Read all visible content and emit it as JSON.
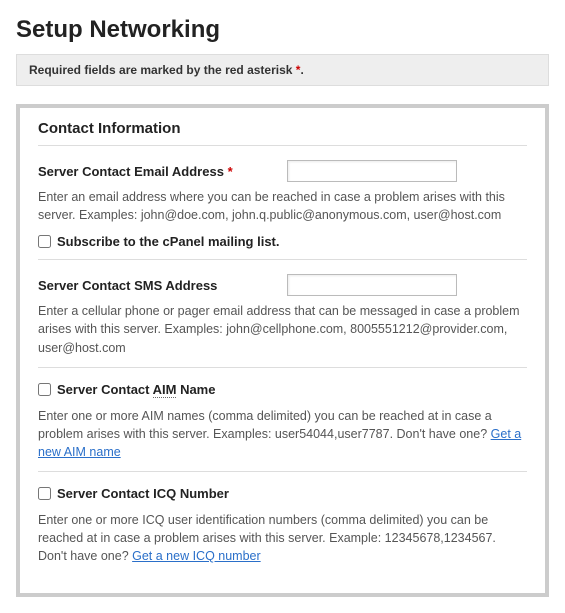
{
  "page": {
    "title": "Setup Networking",
    "required_notice_prefix": "Required fields are marked by the red asterisk ",
    "asterisk": "*",
    "required_notice_suffix": "."
  },
  "panel": {
    "title": "Contact Information",
    "email": {
      "label": "Server Contact Email Address",
      "required_mark": "*",
      "value": "",
      "help": "Enter an email address where you can be reached in case a problem arises with this server. Examples: john@doe.com, john.q.public@anonymous.com, user@host.com"
    },
    "subscribe": {
      "label": "Subscribe to the cPanel mailing list."
    },
    "sms": {
      "label": "Server Contact SMS Address",
      "value": "",
      "help": "Enter a cellular phone or pager email address that can be messaged in case a problem arises with this server. Examples: john@cellphone.com, 8005551212@provider.com, user@host.com"
    },
    "aim": {
      "label_prefix": "Server Contact ",
      "label_acronym": "AIM",
      "label_suffix": " Name",
      "help_prefix": "Enter one or more AIM names (comma delimited) you can be reached at in case a problem arises with this server. Examples: user54044,user7787. Don't have one? ",
      "link_text": "Get a new AIM name"
    },
    "icq": {
      "label": "Server Contact ICQ Number",
      "help_prefix": "Enter one or more ICQ user identification numbers (comma delimited) you can be reached at in case a problem arises with this server. Example: 12345678,1234567. Don't have one? ",
      "link_text": "Get a new ICQ number"
    }
  }
}
